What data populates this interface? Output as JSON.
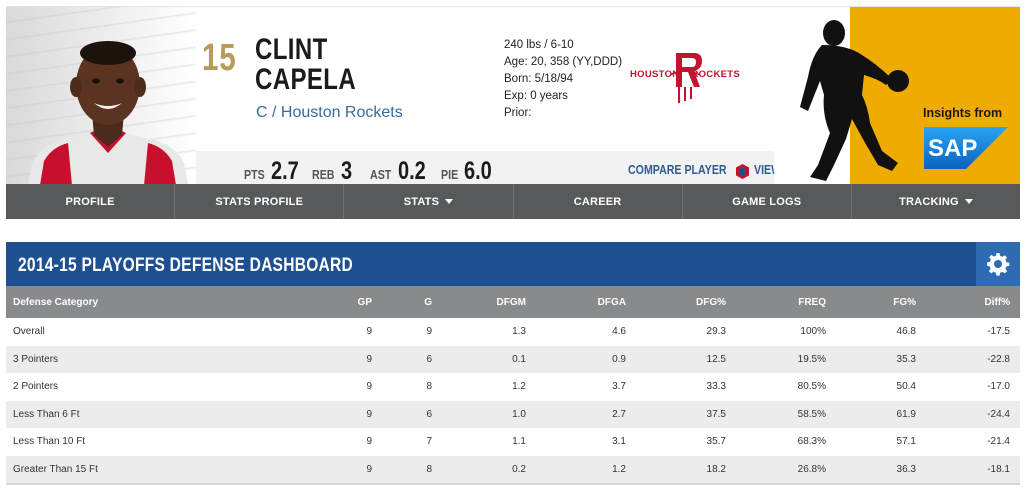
{
  "player": {
    "number": "15",
    "first_name": "CLINT",
    "last_name": "CAPELA",
    "position_team": "C / Houston Rockets",
    "bio": {
      "size": "240 lbs / 6-10",
      "age": "Age: 20, 358 (YY,DDD)",
      "born": "Born: 5/18/94",
      "exp": "Exp: 0 years",
      "prior": "Prior:"
    }
  },
  "team_logo": {
    "left_text": "HOUSTON",
    "right_text": "ROCKETS",
    "color": "#c4122f"
  },
  "stats": [
    {
      "label": "PTS",
      "value": "2.7"
    },
    {
      "label": "REB",
      "value": "3"
    },
    {
      "label": "AST",
      "value": "0.2"
    },
    {
      "label": "PIE",
      "value": "6.0"
    }
  ],
  "links": {
    "compare": "COMPARE PLAYER",
    "dleague": "VIEW D-LEAGUE STATS"
  },
  "promo": {
    "insights": "Insights from",
    "sap": "SAP"
  },
  "nav": [
    {
      "label": "PROFILE",
      "dropdown": false
    },
    {
      "label": "STATS PROFILE",
      "dropdown": false
    },
    {
      "label": "STATS",
      "dropdown": true
    },
    {
      "label": "CAREER",
      "dropdown": false
    },
    {
      "label": "GAME LOGS",
      "dropdown": false
    },
    {
      "label": "TRACKING",
      "dropdown": true
    }
  ],
  "dashboard": {
    "title": "2014-15 PLAYOFFS DEFENSE DASHBOARD",
    "columns": [
      "Defense Category",
      "GP",
      "G",
      "DFGM",
      "DFGA",
      "DFG%",
      "FREQ",
      "FG%",
      "Diff%"
    ],
    "rows": [
      [
        "Overall",
        "9",
        "9",
        "1.3",
        "4.6",
        "29.3",
        "100%",
        "46.8",
        "-17.5"
      ],
      [
        "3 Pointers",
        "9",
        "6",
        "0.1",
        "0.9",
        "12.5",
        "19.5%",
        "35.3",
        "-22.8"
      ],
      [
        "2 Pointers",
        "9",
        "8",
        "1.2",
        "3.7",
        "33.3",
        "80.5%",
        "50.4",
        "-17.0"
      ],
      [
        "Less Than 6 Ft",
        "9",
        "6",
        "1.0",
        "2.7",
        "37.5",
        "58.5%",
        "61.9",
        "-24.4"
      ],
      [
        "Less Than 10 Ft",
        "9",
        "7",
        "1.1",
        "3.1",
        "35.7",
        "68.3%",
        "57.1",
        "-21.4"
      ],
      [
        "Greater Than 15 Ft",
        "9",
        "8",
        "0.2",
        "1.2",
        "18.2",
        "26.8%",
        "36.3",
        "-18.1"
      ]
    ]
  },
  "colors": {
    "nav_bg": "#58595b",
    "dash_header": "#1d4f91",
    "gear_bg": "#2f6bb3",
    "table_header": "#898a8c",
    "link": "#2f5d8f",
    "sap_yellow": "#f0ab00",
    "sap_blue": "#1f7fd0",
    "gold": "#b89a5a"
  }
}
